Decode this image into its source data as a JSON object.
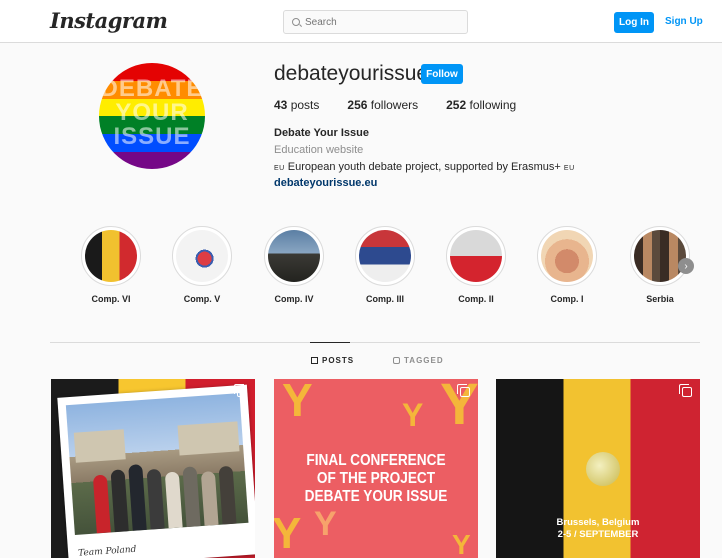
{
  "topbar": {
    "logo": "Instagram",
    "search_placeholder": "Search",
    "login_label": "Log In",
    "signup_label": "Sign Up"
  },
  "profile": {
    "avatar_text": [
      "DEBATE",
      "YOUR",
      "ISSUE"
    ],
    "username": "debateyourissue",
    "follow_label": "Follow",
    "posts_count": "43",
    "posts_label": "posts",
    "followers_count": "256",
    "followers_label": "followers",
    "following_count": "252",
    "following_label": "following",
    "name": "Debate Your Issue",
    "category": "Education website",
    "bio_prefix": "EU",
    "bio": "European youth debate project, supported by Erasmus+",
    "bio_suffix": "EU",
    "link": "debateyourissue.eu"
  },
  "highlights": [
    {
      "label": "Comp. VI"
    },
    {
      "label": "Comp. V"
    },
    {
      "label": "Comp. IV"
    },
    {
      "label": "Comp. III"
    },
    {
      "label": "Comp. II"
    },
    {
      "label": "Comp. I"
    },
    {
      "label": "Serbia"
    }
  ],
  "tabs": {
    "posts": "POSTS",
    "tagged": "TAGGED"
  },
  "posts": [
    {
      "caption": "Team Poland"
    },
    {
      "text": [
        "FINAL CONFERENCE",
        "OF THE PROJECT",
        "DEBATE YOUR ISSUE"
      ]
    },
    {
      "text": [
        "Brussels, Belgium",
        "2-5 / SEPTEMBER"
      ]
    }
  ],
  "colors": {
    "accent": "#0095f6",
    "link": "#00376b",
    "border": "#dbdbdb",
    "muted": "#8e8e8e"
  },
  "icons": {
    "search": "search-icon",
    "chevron": "chevron-right-icon",
    "posts_tab": "grid-icon",
    "tagged_tab": "tag-icon",
    "multi_post": "carousel-icon"
  }
}
